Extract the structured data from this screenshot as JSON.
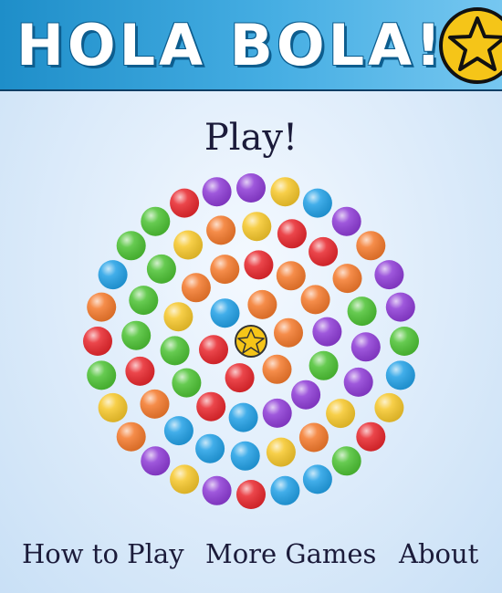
{
  "header": {
    "title": "HOLA BOLA!",
    "logo_icon": "star-icon"
  },
  "menu": {
    "play_label": "Play!",
    "how_to_play_label": "How to Play",
    "more_games_label": "More Games",
    "about_label": "About"
  },
  "colors": {
    "header_blue": "#2a9ad3",
    "star_fill": "#f5c518",
    "red": "#e8262c",
    "orange": "#f4792b",
    "yellow": "#f6c72a",
    "green": "#4cc233",
    "blue": "#21a0e6",
    "purple": "#8e3bd6"
  },
  "board": {
    "center_icon": "star-icon",
    "rings": [
      [
        "orange",
        "orange",
        "orange",
        "red",
        "red",
        "blue"
      ],
      [
        "red",
        "orange",
        "orange",
        "purple",
        "green",
        "purple",
        "purple",
        "blue",
        "red",
        "green",
        "green",
        "yellow",
        "orange",
        "orange"
      ],
      [
        "yellow",
        "red",
        "red",
        "orange",
        "green",
        "purple",
        "purple",
        "yellow",
        "orange",
        "yellow",
        "blue",
        "blue",
        "blue",
        "orange",
        "red",
        "green",
        "green",
        "green",
        "yellow",
        "orange"
      ],
      [
        "purple",
        "yellow",
        "blue",
        "purple",
        "orange",
        "purple",
        "purple",
        "green",
        "blue",
        "yellow",
        "red",
        "green",
        "blue",
        "blue",
        "red",
        "purple",
        "yellow",
        "purple",
        "orange",
        "yellow",
        "green",
        "red",
        "orange",
        "blue",
        "green",
        "green",
        "red",
        "purple"
      ]
    ]
  }
}
